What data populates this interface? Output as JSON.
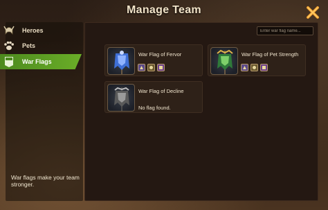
{
  "window": {
    "title": "Manage Team"
  },
  "sidebar": {
    "items": [
      {
        "label": "Heroes",
        "icon": "helmet-icon",
        "active": false
      },
      {
        "label": "Pets",
        "icon": "paw-icon",
        "active": false
      },
      {
        "label": "War Flags",
        "icon": "flag-icon",
        "active": true
      }
    ],
    "hint": "War flags make your team stronger."
  },
  "search": {
    "placeholder": "Enter war flag name..."
  },
  "flags": [
    {
      "name": "War Flag of Fervor",
      "status": "",
      "color": "#3f6fd6",
      "runes": 3
    },
    {
      "name": "War Flag of Pet Strength",
      "status": "",
      "color": "#2f7a3a",
      "runes": 3
    },
    {
      "name": "War Flag of Decline",
      "status": "No flag found.",
      "color": "#8a8a8a",
      "runes": 0
    }
  ],
  "colors": {
    "accent": "#6aae28",
    "close": "#f0a032"
  }
}
